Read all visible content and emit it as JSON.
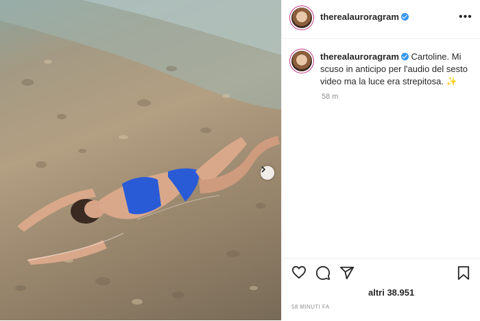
{
  "post": {
    "username": "therealauroragram",
    "more_label": "•••",
    "caption": "Cartoline. Mi scuso in anticipo per l'audio del sesto video ma la luce era strepitosa. ✨",
    "caption_time": "58 m",
    "likes_text": "altri 38.951",
    "date_text": "58 MINUTI FA"
  },
  "icons": {
    "next": "chevron-right-icon",
    "like": "heart-icon",
    "comment": "comment-icon",
    "share": "paper-plane-icon",
    "save": "bookmark-icon"
  },
  "colors": {
    "verified": "#3897f0",
    "text": "#262626",
    "muted": "#8e8e8e",
    "border": "#efefef"
  }
}
